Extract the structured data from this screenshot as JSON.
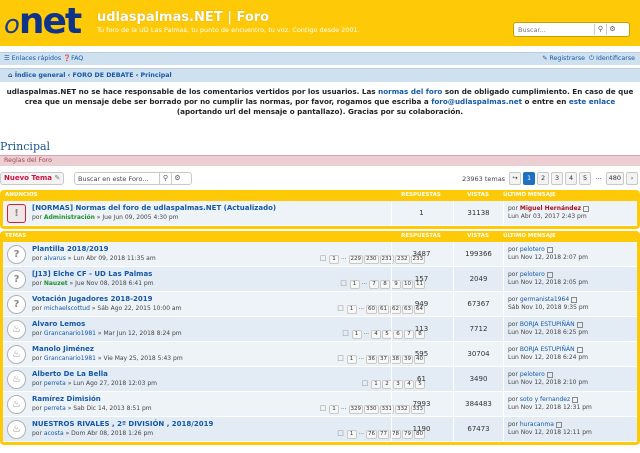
{
  "header": {
    "logo_o": "o",
    "logo_net": "net",
    "site_title": "udlaspalmas.NET | Foro",
    "site_subtitle": "Tu foro de la UD Las Palmas, tu punto de encuentro, tu voz. Contigo desde 2001.",
    "search_placeholder": "Buscar..."
  },
  "nav": {
    "quick_links": "Enlaces rápidos",
    "faq": "FAQ",
    "register": "Registrarse",
    "login": "Identificarse",
    "breadcrumb": [
      "Índice general",
      "FORO DE DEBATE",
      "Principal"
    ]
  },
  "notice": {
    "t1": "udlaspalmas.NET no se hace responsable de los comentarios vertidos por los usuarios. Las ",
    "l1": "normas del foro",
    "t2": " son de obligado cumplimiento. En caso de que crea que un mensaje debe ser borrado por no cumplir las normas, por favor, rogamos que escriba a ",
    "l2": "foro@udlaspalmas.net",
    "t3": " o entre en ",
    "l3": "este enlace",
    "t4": " (aportando url del mensaje o pantallazo). Gracias por su colaboración."
  },
  "forum": {
    "title": "Principal",
    "rules": "Reglas del Foro",
    "new_topic": "Nuevo Tema",
    "search_forum": "Buscar en este Foro...",
    "topic_count": "23963 temas",
    "pages": [
      "1",
      "2",
      "3",
      "4",
      "5",
      "…",
      "480"
    ]
  },
  "columns": {
    "announcements": "ANUNCIOS",
    "topics": "TEMAS",
    "replies": "RESPUESTAS",
    "views": "VISTAS",
    "last": "ÚLTIMO MENSAJE"
  },
  "announcements": [
    {
      "title": "[NORMAS] Normas del foro de udlaspalmas.NET (Actualizado)",
      "by": "por ",
      "author": "Administración",
      "date": " » Jue Jun 09, 2005 4:30 pm",
      "replies": "1",
      "views": "31138",
      "last_by": "Miguel Hernández",
      "last_date": "Lun Abr 03, 2017 2:43 pm"
    }
  ],
  "topics": [
    {
      "title": "Plantilla 2018/2019",
      "by": "por ",
      "author": "alvarus",
      "date": " » Lun Abr 09, 2018 11:35 am",
      "pages": [
        "1",
        "…",
        "229",
        "230",
        "231",
        "232",
        "233"
      ],
      "replies": "3487",
      "views": "199366",
      "last_by": "pelotero",
      "last_date": "Lun Nov 12, 2018 2:07 pm"
    },
    {
      "title": "[J13] Elche CF - UD Las Palmas",
      "by": "por ",
      "author": "Nauzet",
      "date": " » Jue Nov 08, 2018 6:41 pm",
      "pages": [
        "1",
        "…",
        "7",
        "8",
        "9",
        "10",
        "11"
      ],
      "replies": "157",
      "views": "2049",
      "last_by": "pelotero",
      "last_date": "Lun Nov 12, 2018 2:05 pm"
    },
    {
      "title": "Votación Jugadores 2018-2019",
      "by": "por ",
      "author": "michaelscottud",
      "date": " » Sáb Ago 22, 2015 10:00 am",
      "pages": [
        "1",
        "…",
        "60",
        "61",
        "62",
        "63",
        "64"
      ],
      "replies": "949",
      "views": "67367",
      "last_by": "germanista1964",
      "last_date": "Sáb Nov 10, 2018 9:35 pm"
    },
    {
      "title": "Alvaro Lemos",
      "by": "por ",
      "author": "Grancanario1981",
      "date": " » Mar Jun 12, 2018 8:24 pm",
      "pages": [
        "1",
        "…",
        "4",
        "5",
        "6",
        "7",
        "8"
      ],
      "replies": "113",
      "views": "7712",
      "last_by": "BORJA ESTUPIÑÁN",
      "last_date": "Lun Nov 12, 2018 6:25 pm"
    },
    {
      "title": "Manolo Jiménez",
      "by": "por ",
      "author": "Grancanario1981",
      "date": " » Vie May 25, 2018 5:43 pm",
      "pages": [
        "1",
        "…",
        "36",
        "37",
        "38",
        "39",
        "40"
      ],
      "replies": "595",
      "views": "30704",
      "last_by": "BORJA ESTUPIÑÁN",
      "last_date": "Lun Nov 12, 2018 6:24 pm"
    },
    {
      "title": "Alberto De La Bella",
      "by": "por ",
      "author": "perreta",
      "date": " » Lun Ago 27, 2018 12:03 pm",
      "pages": [
        "1",
        "2",
        "3",
        "4",
        "5"
      ],
      "replies": "61",
      "views": "3490",
      "last_by": "pelotero",
      "last_date": "Lun Nov 12, 2018 2:10 pm"
    },
    {
      "title": "Ramírez Dimisión",
      "by": "por ",
      "author": "perreta",
      "date": " » Sab Dic 14, 2013 8:51 pm",
      "pages": [
        "1",
        "…",
        "329",
        "330",
        "331",
        "332",
        "333"
      ],
      "replies": "7993",
      "views": "384483",
      "last_by": "soto y fernandez",
      "last_date": "Lun Nov 12, 2018 12:31 pm"
    },
    {
      "title": "NUESTROS RIVALES , 2º DIVISIÓN , 2018/2019",
      "by": "por ",
      "author": "acosta",
      "date": " » Dom Abr 08, 2018 1:26 pm",
      "pages": [
        "1",
        "…",
        "76",
        "77",
        "78",
        "79",
        "80"
      ],
      "replies": "1190",
      "views": "67473",
      "last_by": "huracanma",
      "last_date": "Lun Nov 12, 2018 12:11 pm"
    }
  ]
}
